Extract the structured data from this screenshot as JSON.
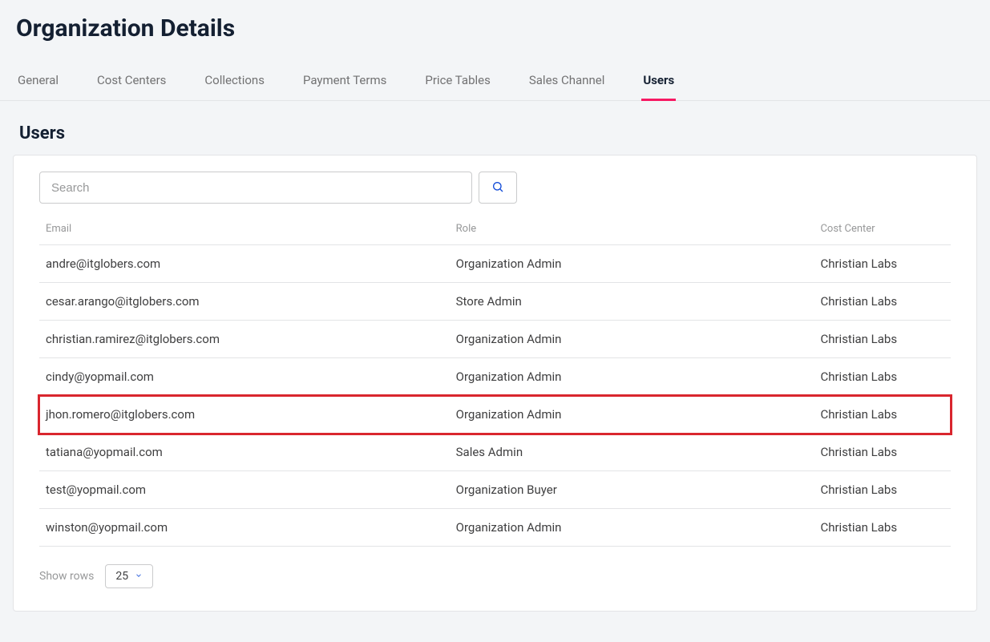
{
  "page_title": "Organization Details",
  "tabs": [
    {
      "label": "General",
      "active": false
    },
    {
      "label": "Cost Centers",
      "active": false
    },
    {
      "label": "Collections",
      "active": false
    },
    {
      "label": "Payment Terms",
      "active": false
    },
    {
      "label": "Price Tables",
      "active": false
    },
    {
      "label": "Sales Channel",
      "active": false
    },
    {
      "label": "Users",
      "active": true
    }
  ],
  "section_title": "Users",
  "search": {
    "placeholder": "Search",
    "value": ""
  },
  "columns": {
    "email": "Email",
    "role": "Role",
    "cost_center": "Cost Center"
  },
  "rows": [
    {
      "email": "andre@itglobers.com",
      "role": "Organization Admin",
      "cost_center": "Christian Labs",
      "highlight": false
    },
    {
      "email": "cesar.arango@itglobers.com",
      "role": "Store Admin",
      "cost_center": "Christian Labs",
      "highlight": false
    },
    {
      "email": "christian.ramirez@itglobers.com",
      "role": "Organization Admin",
      "cost_center": "Christian Labs",
      "highlight": false
    },
    {
      "email": "cindy@yopmail.com",
      "role": "Organization Admin",
      "cost_center": "Christian Labs",
      "highlight": false
    },
    {
      "email": "jhon.romero@itglobers.com",
      "role": "Organization Admin",
      "cost_center": "Christian Labs",
      "highlight": true
    },
    {
      "email": "tatiana@yopmail.com",
      "role": "Sales Admin",
      "cost_center": "Christian Labs",
      "highlight": false
    },
    {
      "email": "test@yopmail.com",
      "role": "Organization Buyer",
      "cost_center": "Christian Labs",
      "highlight": false
    },
    {
      "email": "winston@yopmail.com",
      "role": "Organization Admin",
      "cost_center": "Christian Labs",
      "highlight": false
    }
  ],
  "pager": {
    "label": "Show rows",
    "page_size": "25"
  }
}
